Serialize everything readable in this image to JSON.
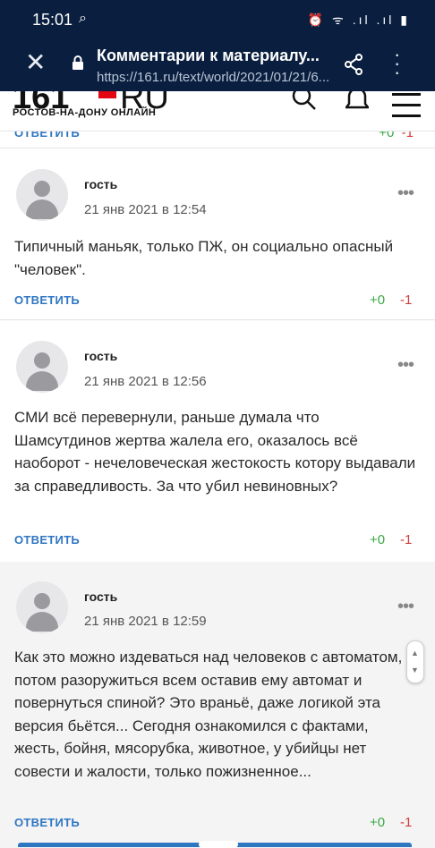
{
  "statusbar": {
    "time": "15:01",
    "icons": "⏰ ᯤ .ıl .ıl ▮"
  },
  "browser": {
    "title": "Комментарии к материалу...",
    "url": "https://161.ru/text/world/2021/01/21/6..."
  },
  "site": {
    "logo_number": "161",
    "logo_suffix": "RU",
    "logo_tagline": "РОСТОВ-НА-ДОНУ ОНЛАЙН",
    "brand_color": "#e30613"
  },
  "previous": {
    "reply_label": "ОТВЕТИТЬ",
    "votes": "+0  -1"
  },
  "comments": [
    {
      "author": "гость",
      "date": "21 янв 2021 в 12:54",
      "text": "Типичный маньяк, только ПЖ, он социально опасный \"человек\".",
      "reply_label": "ОТВЕТИТЬ",
      "plus": "+0",
      "minus": "-1"
    },
    {
      "author": "гость",
      "date": "21 янв 2021 в 12:56",
      "text": "СМИ всё перевернули, раньше думала что Шамсутдинов жертва жалела его, оказалось всё наоборот - нечеловеческая жестокость котору выдавали за справедливость. За что убил невиновных?",
      "reply_label": "ОТВЕТИТЬ",
      "plus": "+0",
      "minus": "-1"
    },
    {
      "author": "гость",
      "date": "21 янв 2021 в 12:59",
      "text": "Как это можно издеваться над человеков с автоматом, а потом разоружиться всем оставив ему автомат и повернуться спиной? Это враньё, даже логикой эта версия бьётся... Сегодня ознакомился с фактами, жесть, бойня, мясорубка, животное, у убийцы нет совести и жалости, только пожизненное...",
      "reply_label": "ОТВЕТИТЬ",
      "plus": "+0",
      "minus": "-1"
    }
  ]
}
